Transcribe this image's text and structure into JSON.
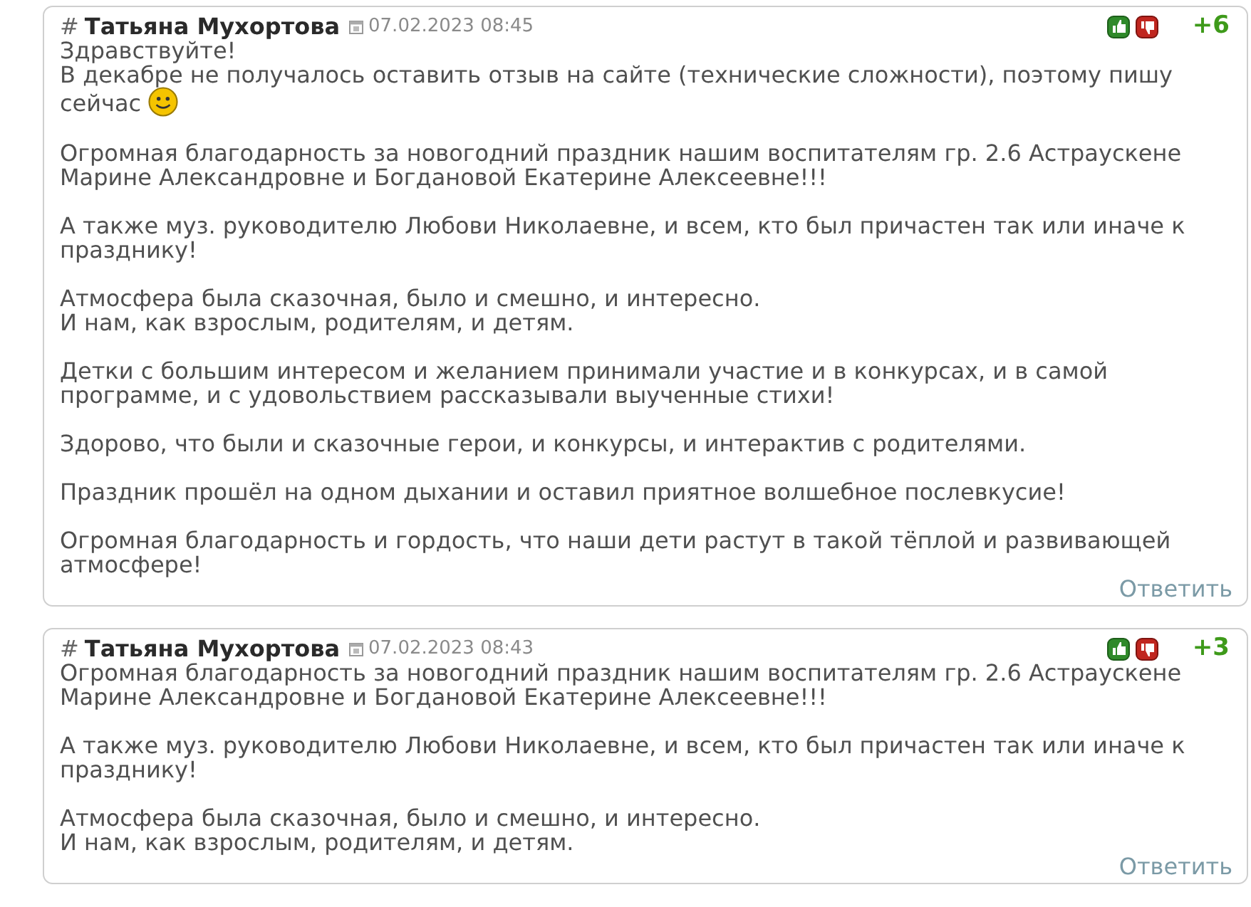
{
  "comments": [
    {
      "hash": "#",
      "author": "Татьяна Мухортова",
      "date": "07.02.2023 08:45",
      "score": "+6",
      "reply": "Ответить",
      "paragraphs": [
        {
          "lines": [
            "Здравствуйте!",
            "В декабре не получалось оставить отзыв на сайте (технические сложности), поэтому пишу",
            "сейчас"
          ],
          "smiley": true
        },
        {
          "lines": [
            "Огромная благодарность за новогодний праздник нашим воспитателям гр. 2.6 Астраускене",
            "Марине Александровне и Богдановой Екатерине Алексеевне!!!"
          ],
          "smiley": false
        },
        {
          "lines": [
            "А также муз. руководителю Любови Николаевне, и всем, кто был причастен так или иначе к",
            "празднику!"
          ],
          "smiley": false
        },
        {
          "lines": [
            "Атмосфера была сказочная, было и смешно, и интересно.",
            "И нам, как взрослым, родителям, и детям."
          ],
          "smiley": false
        },
        {
          "lines": [
            "Детки с большим интересом и желанием принимали участие и в конкурсах, и в самой",
            "программе, и с удовольствием рассказывали выученные стихи!"
          ],
          "smiley": false
        },
        {
          "lines": [
            "Здорово, что были и сказочные герои, и конкурсы, и интерактив с родителями."
          ],
          "smiley": false
        },
        {
          "lines": [
            "Праздник прошёл на одном дыхании и оставил приятное волшебное послевкусие!"
          ],
          "smiley": false
        },
        {
          "lines": [
            "Огромная благодарность и гордость, что наши дети растут в такой тёплой и развивающей",
            "атмосфере!"
          ],
          "smiley": false
        }
      ]
    },
    {
      "hash": "#",
      "author": "Татьяна Мухортова",
      "date": "07.02.2023 08:43",
      "score": "+3",
      "reply": "Ответить",
      "paragraphs": [
        {
          "lines": [
            "Огромная благодарность за новогодний праздник нашим воспитателям гр. 2.6 Астраускене",
            "Марине Александровне и Богдановой Екатерине Алексеевне!!!"
          ],
          "smiley": false
        },
        {
          "lines": [
            "А также муз. руководителю Любови Николаевне, и всем, кто был причастен так или иначе к",
            "празднику!"
          ],
          "smiley": false
        },
        {
          "lines": [
            "Атмосфера была сказочная, было и смешно, и интересно.",
            "И нам, как взрослым, родителям, и детям."
          ],
          "smiley": false
        }
      ]
    }
  ]
}
